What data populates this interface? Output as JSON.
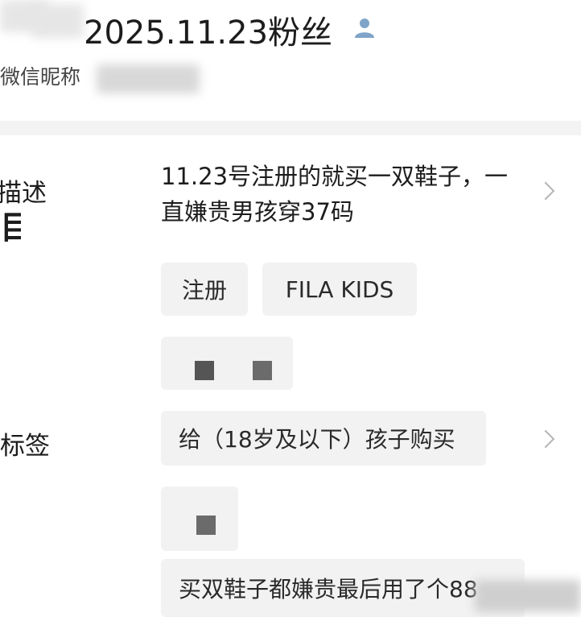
{
  "header": {
    "title": "2025.11.23粉丝",
    "nickname": "微信昵称",
    "user_icon": "user-icon"
  },
  "labels": {
    "description": "描述",
    "description_partial": "描述",
    "big_char": "目",
    "tags": "标签"
  },
  "description_text": "11.23号注册的就买一双鞋子，一直嫌贵男孩穿37码",
  "tags": [
    "注册",
    "FILA KIDS"
  ],
  "purchase_row": "给（18岁及以下）孩子购买",
  "note_row": "买双鞋子都嫌贵最后用了个88"
}
